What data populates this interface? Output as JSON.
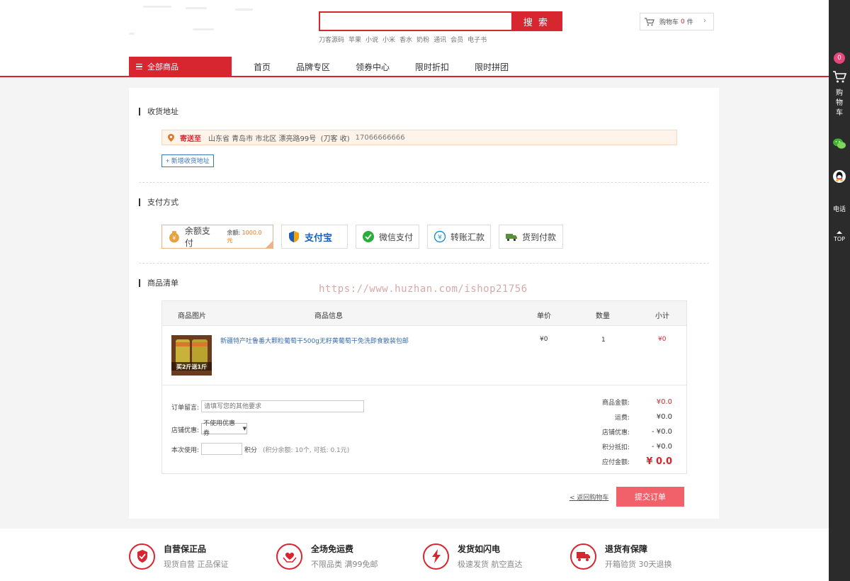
{
  "search": {
    "placeholder": "",
    "button_label": "搜 索"
  },
  "hot_words": [
    "刀客源码",
    "苹果",
    "小说",
    "小米",
    "香水",
    "奶粉",
    "通讯",
    "会员",
    "电子书"
  ],
  "mini_cart": {
    "label": "购物车",
    "count": "0",
    "unit": "件",
    "arrow": "›"
  },
  "nav": {
    "all_categories": "全部商品",
    "links": [
      "首页",
      "品牌专区",
      "领券中心",
      "限时折扣",
      "限时拼团"
    ]
  },
  "address_section": {
    "title": "收货地址",
    "ship_to_label": "寄送至",
    "address": "山东省 青岛市 市北区 漂亮路99号",
    "receiver": "(刀客 收)",
    "phone": "17066666666",
    "add_button": "+ 新增收货地址"
  },
  "payment_section": {
    "title": "支付方式",
    "methods": [
      {
        "label": "余额支付",
        "balance_label": "余额:",
        "balance": "1000.0元",
        "selected": true
      },
      {
        "label": "支付宝",
        "selected": false
      },
      {
        "label": "微信支付",
        "selected": false
      },
      {
        "label": "转账汇款",
        "selected": false
      },
      {
        "label": "货到付款",
        "selected": false
      }
    ]
  },
  "watermark": "https://www.huzhan.com/ishop21756",
  "goods_section": {
    "title": "商品清单",
    "headers": {
      "image": "商品图片",
      "info": "商品信息",
      "price": "单价",
      "qty": "数量",
      "subtotal": "小计"
    },
    "items": [
      {
        "name": "新疆特产吐鲁番大颗粒葡萄干500g无籽黄葡萄干免洗即食散装包邮",
        "price": "¥0",
        "qty": "1",
        "subtotal": "¥0",
        "thumb_text": "买2斤送1斤"
      }
    ]
  },
  "order_options": {
    "memo_label": "订单留言:",
    "memo_placeholder": "请填写您的其他要求",
    "coupon_label": "店铺优惠:",
    "coupon_value": "不使用优惠券",
    "points_label": "本次使用:",
    "points_unit": "积分",
    "points_note": "(积分余额: 10个, 可抵: 0.1元)"
  },
  "summary": {
    "rows": [
      {
        "label": "商品金额:",
        "value": "¥0.0",
        "style": "red"
      },
      {
        "label": "运费:",
        "value": "¥0.0",
        "style": "normal"
      },
      {
        "label": "店铺优惠:",
        "value": "- ¥0.0",
        "style": "normal"
      },
      {
        "label": "积分抵扣:",
        "value": "- ¥0.0",
        "style": "normal"
      },
      {
        "label": "应付金额:",
        "value": "¥ 0.0",
        "style": "big"
      }
    ]
  },
  "actions": {
    "back_to_cart": "< 返回购物车",
    "submit": "提交订单"
  },
  "footer": {
    "services": [
      {
        "title": "自营保正品",
        "desc": "现货自营 正品保证",
        "icon": "shield-icon"
      },
      {
        "title": "全场免运费",
        "desc": "不限品类 满99免邮",
        "icon": "heart-hands-icon"
      },
      {
        "title": "发货如闪电",
        "desc": "极速发货 航空直达",
        "icon": "lightning-icon"
      },
      {
        "title": "退货有保障",
        "desc": "开箱验货 30天退换",
        "icon": "truck-icon"
      }
    ]
  },
  "right_bar": {
    "cart_count": "0",
    "cart_label": "购物车",
    "phone_label": "电话",
    "top_label": "TOP"
  },
  "colors": {
    "brand_red": "#d7262f",
    "submit_pink": "#f0616a",
    "link_blue": "#3a6eb0",
    "sidebar_dark": "#2b2b2b"
  }
}
